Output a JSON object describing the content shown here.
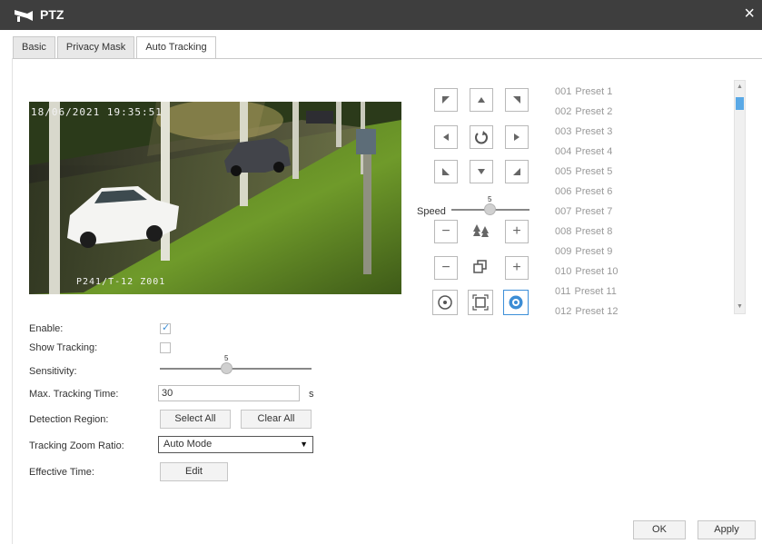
{
  "window": {
    "title": "PTZ",
    "close_symbol": "×"
  },
  "tabs": [
    "Basic",
    "Privacy Mask",
    "Auto Tracking"
  ],
  "active_tab": "Auto Tracking",
  "video": {
    "timestamp": "18/06/2021 19:35:51",
    "camera_label": "P241/T-12 Z001"
  },
  "ptz": {
    "speed_label": "Speed",
    "speed_value": "5",
    "minus_symbol": "−",
    "plus_symbol": "+"
  },
  "presets": [
    {
      "num": "001",
      "name": "Preset 1"
    },
    {
      "num": "002",
      "name": "Preset 2"
    },
    {
      "num": "003",
      "name": "Preset 3"
    },
    {
      "num": "004",
      "name": "Preset 4"
    },
    {
      "num": "005",
      "name": "Preset 5"
    },
    {
      "num": "006",
      "name": "Preset 6"
    },
    {
      "num": "007",
      "name": "Preset 7"
    },
    {
      "num": "008",
      "name": "Preset 8"
    },
    {
      "num": "009",
      "name": "Preset 9"
    },
    {
      "num": "010",
      "name": "Preset 10"
    },
    {
      "num": "011",
      "name": "Preset 11"
    },
    {
      "num": "012",
      "name": "Preset 12"
    }
  ],
  "form": {
    "enable_label": "Enable:",
    "enable_checked": true,
    "show_tracking_label": "Show Tracking:",
    "show_tracking_checked": false,
    "sensitivity_label": "Sensitivity:",
    "sensitivity_value": "5",
    "max_time_label": "Max. Tracking Time:",
    "max_time_value": "30",
    "max_time_unit": "s",
    "detection_region_label": "Detection Region:",
    "select_all": "Select All",
    "clear_all": "Clear All",
    "zoom_ratio_label": "Tracking Zoom Ratio:",
    "zoom_ratio_value": "Auto Mode",
    "effective_time_label": "Effective Time:",
    "edit": "Edit"
  },
  "footer": {
    "ok": "OK",
    "apply": "Apply"
  },
  "colors": {
    "titlebar": "#3e3e3e",
    "accent": "#3c8dd5",
    "preset_text": "#999999"
  }
}
